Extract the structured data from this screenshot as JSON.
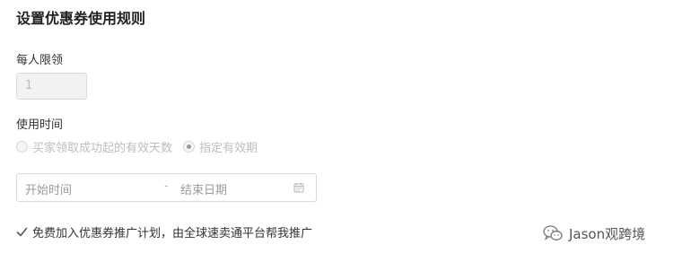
{
  "section_title": "设置优惠券使用规则",
  "per_person_limit": {
    "label": "每人限领",
    "value": "1"
  },
  "usage_time": {
    "label": "使用时间",
    "options": [
      {
        "label": "买家领取成功起的有效天数",
        "selected": false
      },
      {
        "label": "指定有效期",
        "selected": true
      }
    ]
  },
  "date_range": {
    "start_placeholder": "开始时间",
    "separator": "-",
    "end_placeholder": "结束日期"
  },
  "promotion_plan": {
    "label": "免费加入优惠券推广计划，由全球速卖通平台帮我推广",
    "checked": true
  },
  "watermark": {
    "text": "Jason观跨境"
  },
  "icons": {
    "calendar": "calendar-icon",
    "checkbox": "checkmark-icon",
    "logo": "wechat-logo-icon"
  }
}
